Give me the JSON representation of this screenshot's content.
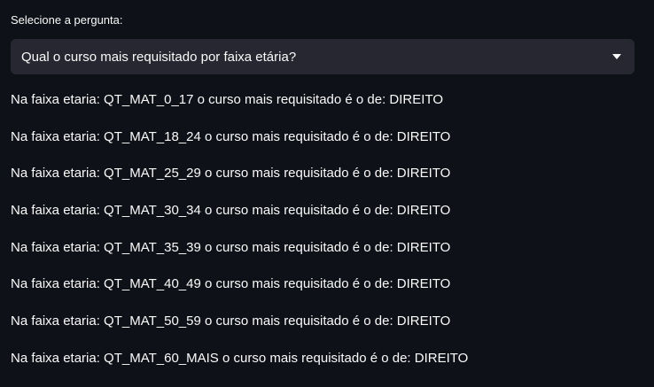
{
  "question_select": {
    "label": "Selecione a pergunta:",
    "selected_value": "Qual o curso mais requisitado por faixa etária?",
    "icon": "chevron-down-icon"
  },
  "results": [
    "Na faixa etaria: QT_MAT_0_17 o curso mais requisitado é o de: DIREITO",
    "Na faixa etaria: QT_MAT_18_24 o curso mais requisitado é o de: DIREITO",
    "Na faixa etaria: QT_MAT_25_29 o curso mais requisitado é o de: DIREITO",
    "Na faixa etaria: QT_MAT_30_34 o curso mais requisitado é o de: DIREITO",
    "Na faixa etaria: QT_MAT_35_39 o curso mais requisitado é o de: DIREITO",
    "Na faixa etaria: QT_MAT_40_49 o curso mais requisitado é o de: DIREITO",
    "Na faixa etaria: QT_MAT_50_59 o curso mais requisitado é o de: DIREITO",
    "Na faixa etaria: QT_MAT_60_MAIS o curso mais requisitado é o de: DIREITO"
  ],
  "colors": {
    "background": "#0e1117",
    "select_background": "#262730",
    "text": "#fafafa"
  }
}
